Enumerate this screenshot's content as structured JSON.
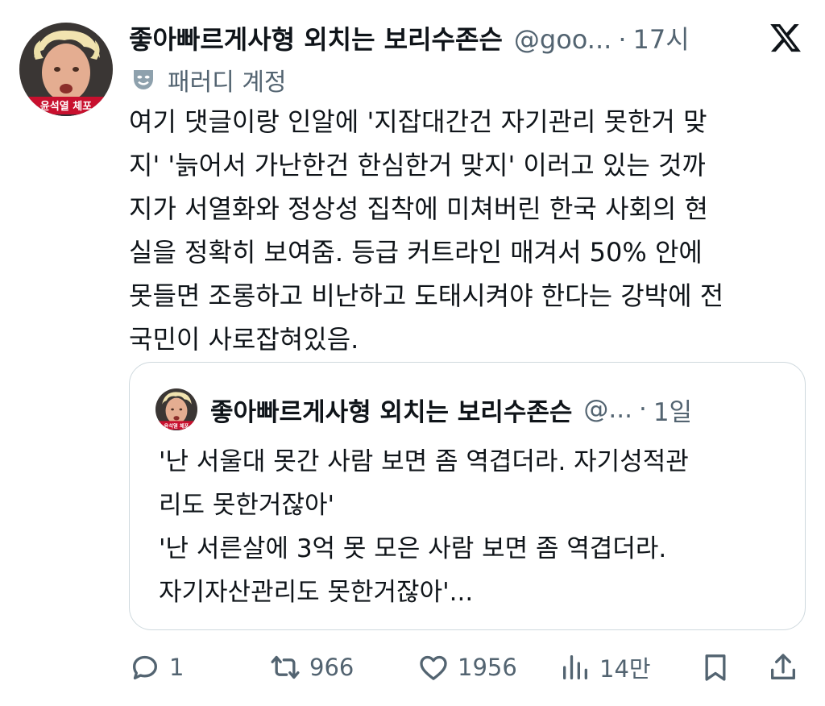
{
  "tweet": {
    "display_name": "좋아빠르게사형 외치는 보리수존슨",
    "handle": "@goo...",
    "separator": "·",
    "time": "17시",
    "avatar_caption": "윤석열 체포",
    "parody_label": "패러디 계정",
    "body": "여기 댓글이랑 인알에 '지잡대간건 자기관리 못한거 맞\n지' '늙어서 가난한건 한심한거 맞지' 이러고 있는 것까\n지가 서열화와 정상성 집착에 미쳐버린 한국 사회의 현\n실을 정확히 보여줌. 등급 커트라인 매겨서 50% 안에\n못들면 조롱하고 비난하고 도태시켜야 한다는 강박에 전\n국민이 사로잡혀있음."
  },
  "quote": {
    "display_name": "좋아빠르게사형 외치는 보리수존슨",
    "handle": "@...",
    "separator": "·",
    "time": "1일",
    "avatar_caption": "윤석열 체포",
    "body": "'난 서울대 못간 사람 보면 좀 역겹더라. 자기성적관\n리도 못한거잖아'\n'난 서른살에 3억 못 모은 사람 보면 좀 역겹더라.\n자기자산관리도 못한거잖아'..."
  },
  "actions": {
    "replies": "1",
    "retweets": "966",
    "likes": "1956",
    "views": "14만"
  },
  "icons": {
    "brand": "x-logo-icon",
    "parody": "theater-mask-icon",
    "reply": "reply-icon",
    "retweet": "retweet-icon",
    "like": "heart-icon",
    "views": "views-icon",
    "bookmark": "bookmark-icon",
    "share": "share-icon"
  },
  "colors": {
    "text": "#0f1419",
    "secondary": "#536471",
    "border": "#cfd9de",
    "caption_bg": "#c8102e"
  }
}
